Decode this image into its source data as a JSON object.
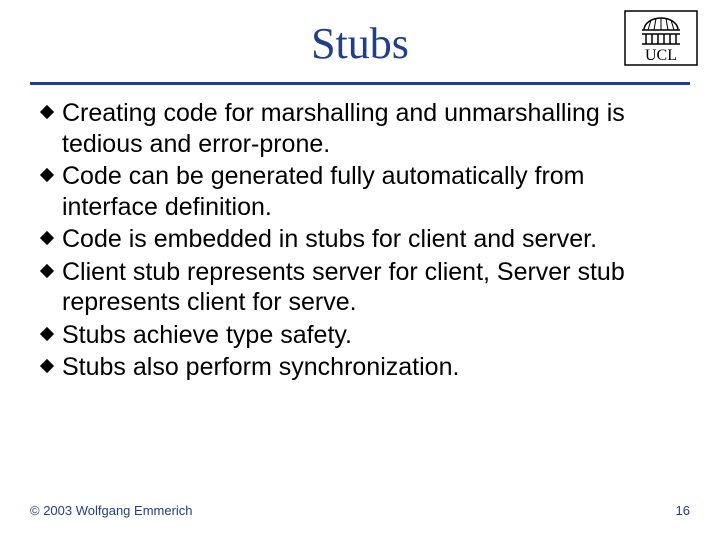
{
  "title": "Stubs",
  "logo_text": "UCL",
  "bullets": [
    "Creating code for marshalling and unmarshalling is tedious and error-prone.",
    "Code can be generated fully automatically from interface definition.",
    "Code is embedded in stubs for client and server.",
    "Client stub represents server for client, Server stub represents client for serve.",
    "Stubs achieve type safety.",
    "Stubs also perform synchronization."
  ],
  "footer": {
    "copyright": "© 2003 Wolfgang Emmerich",
    "page": "16"
  }
}
